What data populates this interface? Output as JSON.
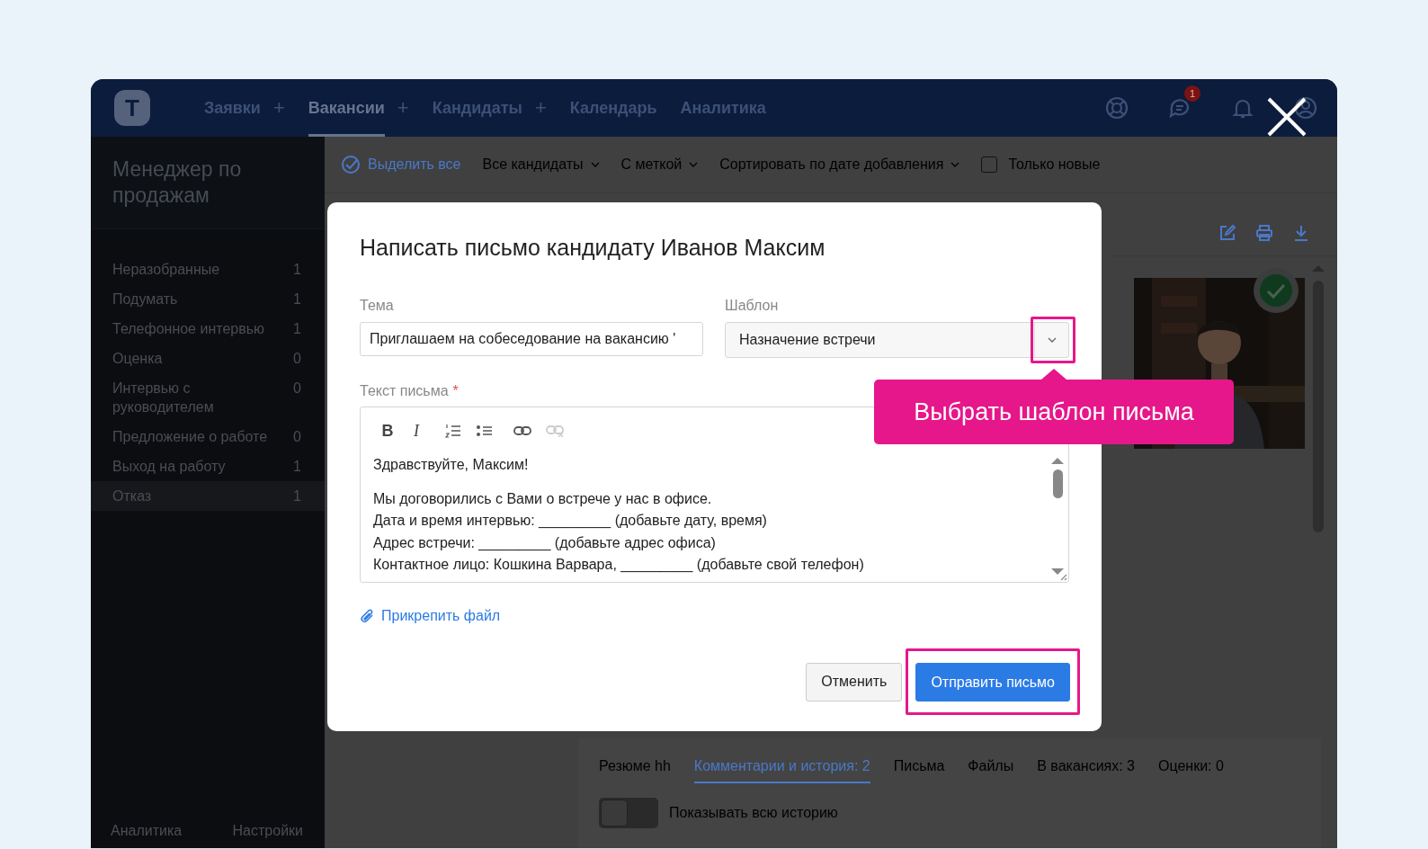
{
  "app": {
    "nav": {
      "logo_letter": "T",
      "items": [
        {
          "label": "Заявки",
          "add": true,
          "selected": false
        },
        {
          "label": "Вакансии",
          "add": true,
          "selected": true
        },
        {
          "label": "Кандидаты",
          "add": true,
          "selected": false
        },
        {
          "label": "Календарь",
          "add": false,
          "selected": false
        },
        {
          "label": "Аналитика",
          "add": false,
          "selected": false
        }
      ],
      "add_sign": "+",
      "chat_badge": "1"
    },
    "sidebar": {
      "title": "Менеджер по продажам",
      "stages": [
        {
          "label": "Неразобранные",
          "count": "1",
          "selected": false
        },
        {
          "label": "Подумать",
          "count": "1",
          "selected": false
        },
        {
          "label": "Телефонное интервью",
          "count": "1",
          "selected": false
        },
        {
          "label": "Оценка",
          "count": "0",
          "selected": false
        },
        {
          "label": "Интервью с руководителем",
          "count": "0",
          "selected": false
        },
        {
          "label": "Предложение о работе",
          "count": "0",
          "selected": false
        },
        {
          "label": "Выход на работу",
          "count": "1",
          "selected": false
        },
        {
          "label": "Отказ",
          "count": "1",
          "selected": true
        }
      ],
      "footer": [
        "Аналитика",
        "Настройки"
      ]
    },
    "toolbar": {
      "select_all": "Выделить все",
      "filters": [
        "Все кандидаты",
        "С меткой",
        "Сортировать по дате добавления"
      ],
      "new_only": {
        "label": "Только новые",
        "checked": false
      }
    },
    "profile_tabs": [
      {
        "label": "Резюме hh",
        "selected": false
      },
      {
        "label": "Комментарии и история: 2",
        "selected": true
      },
      {
        "label": "Письма",
        "selected": false
      },
      {
        "label": "Файлы",
        "selected": false
      },
      {
        "label": "В вакансиях: 3",
        "selected": false
      },
      {
        "label": "Оценки: 0",
        "selected": false
      }
    ],
    "history_toggle": {
      "label": "Показывать всю историю",
      "on": false
    }
  },
  "dialog": {
    "title": "Написать письмо кандидату Иванов Максим",
    "subject": {
      "label": "Тема",
      "value": "Приглашаем на собеседование на вакансию '"
    },
    "template": {
      "label": "Шаблон",
      "value": "Назначение встречи",
      "highlighted": true
    },
    "body": {
      "label": "Текст письма",
      "required": true,
      "required_mark": "*",
      "bold_label": "B",
      "italic_label": "I",
      "paragraphs": [
        {
          "lines": [
            "Здравствуйте, Максим!"
          ]
        },
        {
          "lines": [
            "Мы договорились с Вами о встрече у нас в офисе.",
            "Дата и время интервью: _________ (добавьте дату, время)",
            "Адрес встречи: _________ (добавьте адрес офиса)",
            "Контактное лицо: Кошкина Варвара, _________ (добавьте свой телефон)"
          ]
        }
      ]
    },
    "attach_link": "Прикрепить файл",
    "buttons": [
      {
        "label": "Отменить",
        "kind": "secondary",
        "highlighted": false
      },
      {
        "label": "Отправить письмо",
        "kind": "primary",
        "highlighted": true
      }
    ]
  },
  "callouts": [
    {
      "text": "Выбрать шаблон письма"
    }
  ]
}
